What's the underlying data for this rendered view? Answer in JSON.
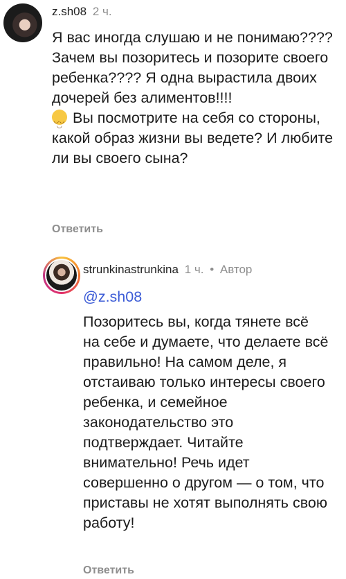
{
  "comments": [
    {
      "username": "z.sh08",
      "time": "2 ч.",
      "text_before_emoji": "Я вас иногда слушаю и не понимаю???? Зачем вы позоритесь и позорите своего ребенка???? Я одна вырастила двоих дочерей без алиментов!!!!",
      "emoji": "smiling-face-emoji",
      "text_after_emoji": "Вы посмотрите на себя со стороны, какой образ жизни вы ведете? И любите ли вы своего сына?",
      "reply_label": "Ответить"
    },
    {
      "username": "strunkinastrunkina",
      "time": "1 ч.",
      "separator": "•",
      "author_label": "Автор",
      "mention": "@z.sh08",
      "text": "Позоритесь вы, когда тянете всё на себе и думаете, что делаете всё правильно! На самом деле, я отстаиваю только интересы своего ребенка, и семейное законодательство это подтверждает. Читайте внимательно! Речь идет совершенно о другом — о том, что приставы не хотят выполнять свою работу!",
      "reply_label": "Ответить"
    }
  ]
}
